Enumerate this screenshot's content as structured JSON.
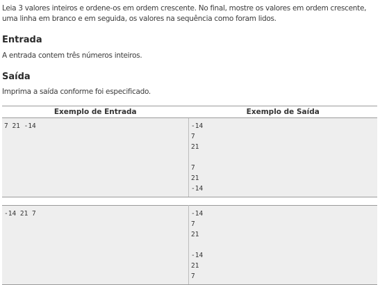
{
  "problem": {
    "description": "Leia 3 valores inteiros e ordene-os em ordem crescente. No final, mostre os valores em ordem crescente, uma linha em branco e em seguida, os valores na sequência como foram lidos."
  },
  "input_section": {
    "title": "Entrada",
    "text": "A entrada contem três números inteiros."
  },
  "output_section": {
    "title": "Saída",
    "text": "Imprima a saída conforme foi especificado."
  },
  "examples": {
    "header_input": "Exemplo de Entrada",
    "header_output": "Exemplo de Saída",
    "cases": [
      {
        "input": "7 21 -14",
        "output": "-14\n7\n21\n\n7\n21\n-14"
      },
      {
        "input": "-14 21 7",
        "output": "-14\n7\n21\n\n-14\n21\n7"
      }
    ]
  }
}
